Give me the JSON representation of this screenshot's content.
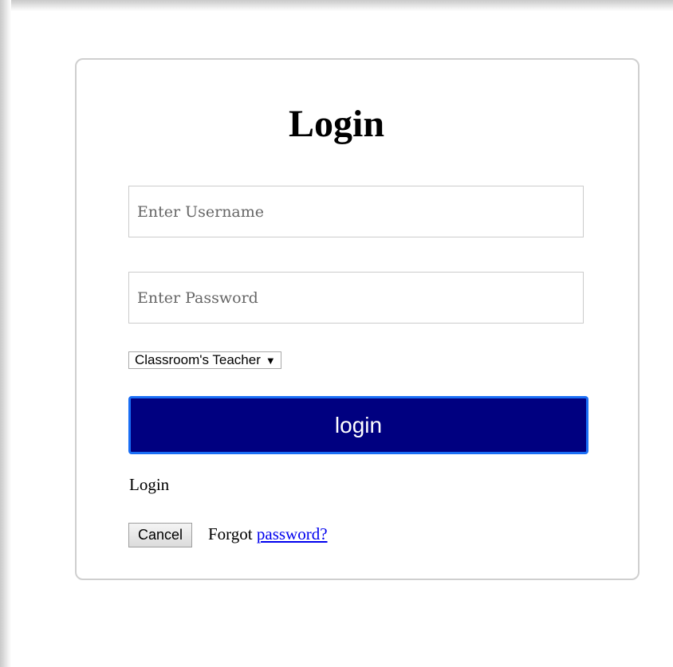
{
  "form": {
    "title": "Login",
    "username": {
      "placeholder": "Enter Username",
      "value": ""
    },
    "password": {
      "placeholder": "Enter Password",
      "value": ""
    },
    "role_select": {
      "selected": "Classroom's Teacher",
      "arrow": "▼",
      "icon": "dropdown-arrow-icon"
    },
    "login_button_label": "login",
    "login_text": "Login",
    "cancel_button_label": "Cancel",
    "forgot_text": "Forgot",
    "forgot_link_text": "password?"
  },
  "colors": {
    "login_button_bg": "#000080",
    "login_button_border": "#1a6ef5",
    "link": "#0000ee",
    "card_border": "#cfcfcf"
  }
}
